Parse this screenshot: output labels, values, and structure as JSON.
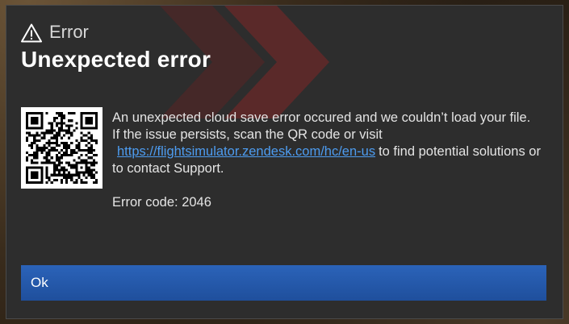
{
  "dialog": {
    "header_label": "Error",
    "title": "Unexpected error",
    "icon": "warning-icon",
    "qr_icon": "qr-code-icon"
  },
  "message": {
    "line1": "An unexpected cloud save error occured and we couldn’t load your file.",
    "line2_prefix": "If the issue persists, scan the QR code or visit",
    "link_text": "https://flightsimulator.zendesk.com/hc/en-us",
    "line2_suffix": "to find potential solutions or to contact Support.",
    "error_code": "Error code: 2046"
  },
  "buttons": {
    "ok_label": "Ok"
  },
  "colors": {
    "dialog_bg": "#2d2d2d",
    "accent_blue": "#2b63b9",
    "link_blue": "#4d9cf0",
    "decor_red": "#7a2a2a"
  }
}
